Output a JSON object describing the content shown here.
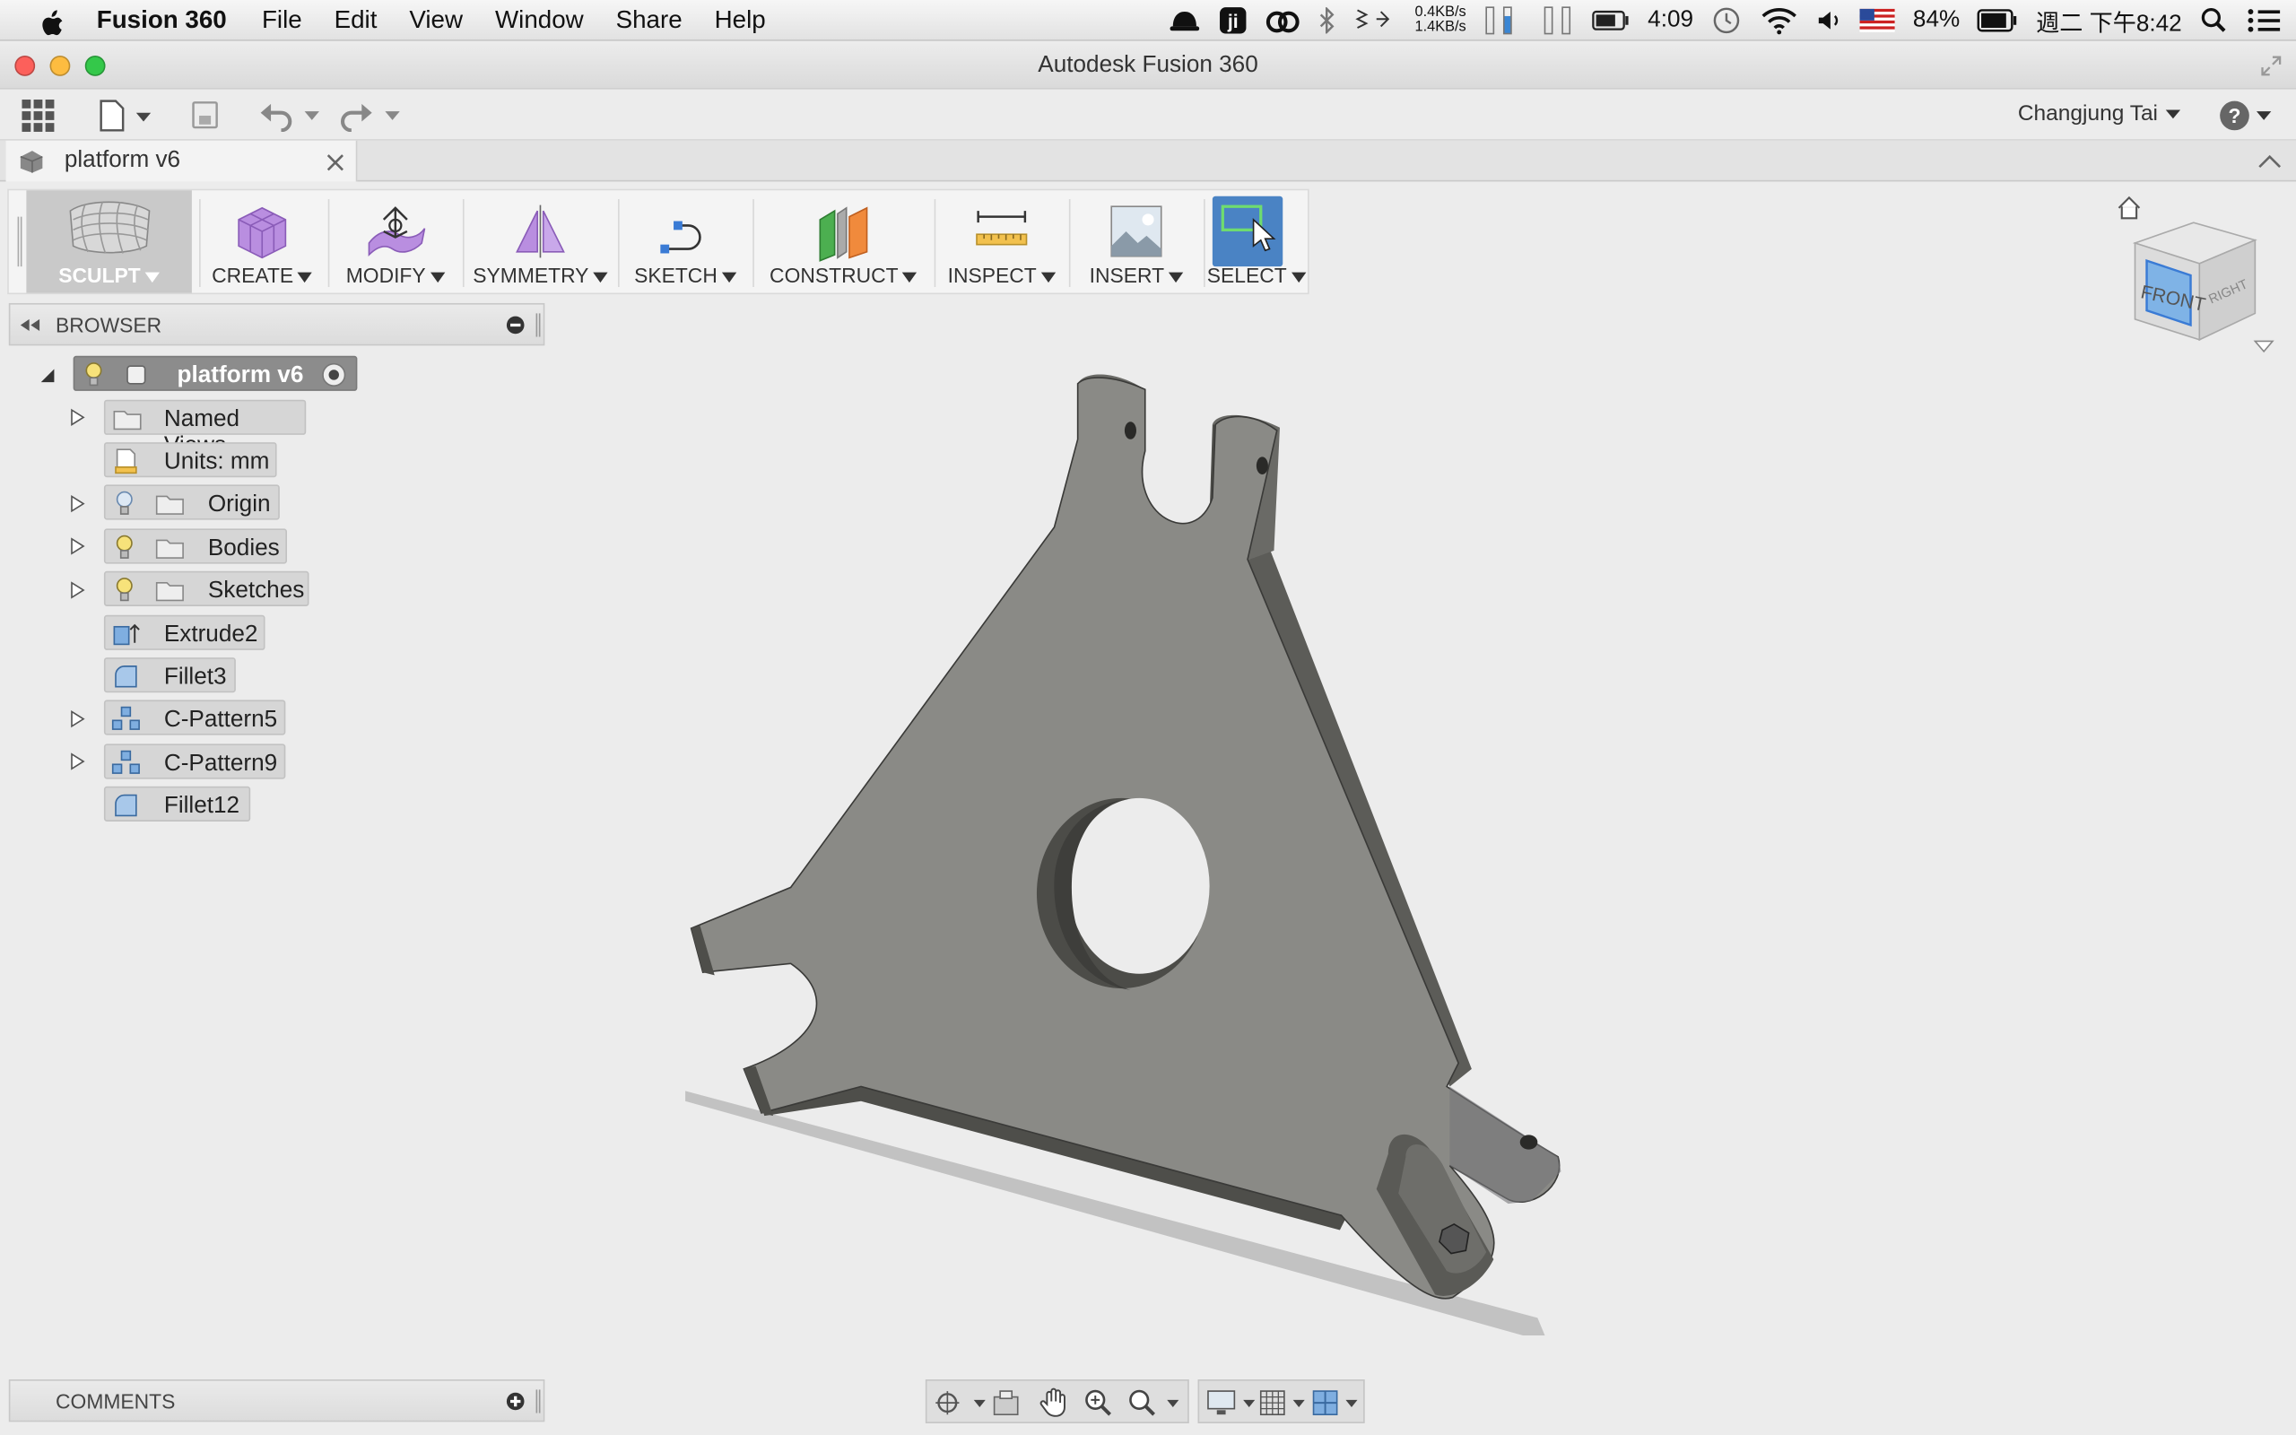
{
  "menubar": {
    "app_name": "Fusion 360",
    "items": [
      "File",
      "Edit",
      "View",
      "Window",
      "Share",
      "Help"
    ],
    "net_up": "0.4KB/s",
    "net_down": "1.4KB/s",
    "time_small": "4:09",
    "battery_percent": "84%",
    "datetime": "週二 下午8:42"
  },
  "window": {
    "title": "Autodesk Fusion 360"
  },
  "toolbar": {
    "user_name": "Changjung Tai"
  },
  "document_tab": {
    "label": "platform v6"
  },
  "ribbon": {
    "workspace": "SCULPT",
    "groups": [
      "CREATE",
      "MODIFY",
      "SYMMETRY",
      "SKETCH",
      "CONSTRUCT",
      "INSPECT",
      "INSERT",
      "SELECT"
    ]
  },
  "browser": {
    "title": "BROWSER",
    "root": "platform v6",
    "items": [
      {
        "label": "Named Views"
      },
      {
        "label": "Units: mm"
      },
      {
        "label": "Origin"
      },
      {
        "label": "Bodies"
      },
      {
        "label": "Sketches"
      },
      {
        "label": "Extrude2"
      },
      {
        "label": "Fillet3"
      },
      {
        "label": "C-Pattern5"
      },
      {
        "label": "C-Pattern9"
      },
      {
        "label": "Fillet12"
      }
    ]
  },
  "viewcube": {
    "front": "FRONT",
    "right": "RIGHT"
  },
  "comments": {
    "title": "COMMENTS"
  },
  "colors": {
    "model": "#8a8a86",
    "select_active": "#4a83c4",
    "sculpt_active": "#c9c9c9"
  }
}
